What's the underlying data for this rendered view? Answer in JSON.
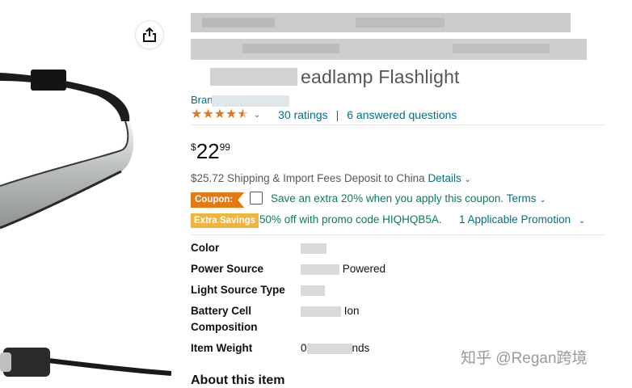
{
  "title": {
    "visible_fragment": "eadlamp Flashlight"
  },
  "brand": {
    "label": "Bran"
  },
  "rating": {
    "stars": 4.5,
    "ratings_text": "30 ratings",
    "separator": "|",
    "questions_text": "6 answered questions"
  },
  "price": {
    "symbol": "$",
    "whole": "22",
    "fraction": "99"
  },
  "shipping": {
    "text": "$25.72 Shipping & Import Fees Deposit to China",
    "details_label": "Details"
  },
  "coupon": {
    "badge": "Coupon:",
    "text": "Save an extra 20% when you apply this coupon.",
    "terms_label": "Terms"
  },
  "promo": {
    "badge": "Extra Savings",
    "text": "50% off with promo code HIQHQB5A.",
    "link": "1 Applicable Promotion"
  },
  "specs": [
    {
      "label": "Color",
      "value": ""
    },
    {
      "label": "Power Source",
      "value": "Powered"
    },
    {
      "label": "Light Source Type",
      "value": ""
    },
    {
      "label": "Battery Cell Composition",
      "value": "Ion"
    },
    {
      "label": "Item Weight",
      "value_prefix": "0",
      "value": "nds"
    }
  ],
  "about": {
    "heading": "About this item"
  },
  "watermark": {
    "text": "知乎 @Regan跨境"
  },
  "colors": {
    "link": "#007185",
    "star": "#de7921",
    "coupon": "#e47911",
    "extra": "#f0b541",
    "green": "#067d62"
  },
  "icons": {
    "share": "share-icon",
    "chevron": "chevron-down-icon"
  }
}
